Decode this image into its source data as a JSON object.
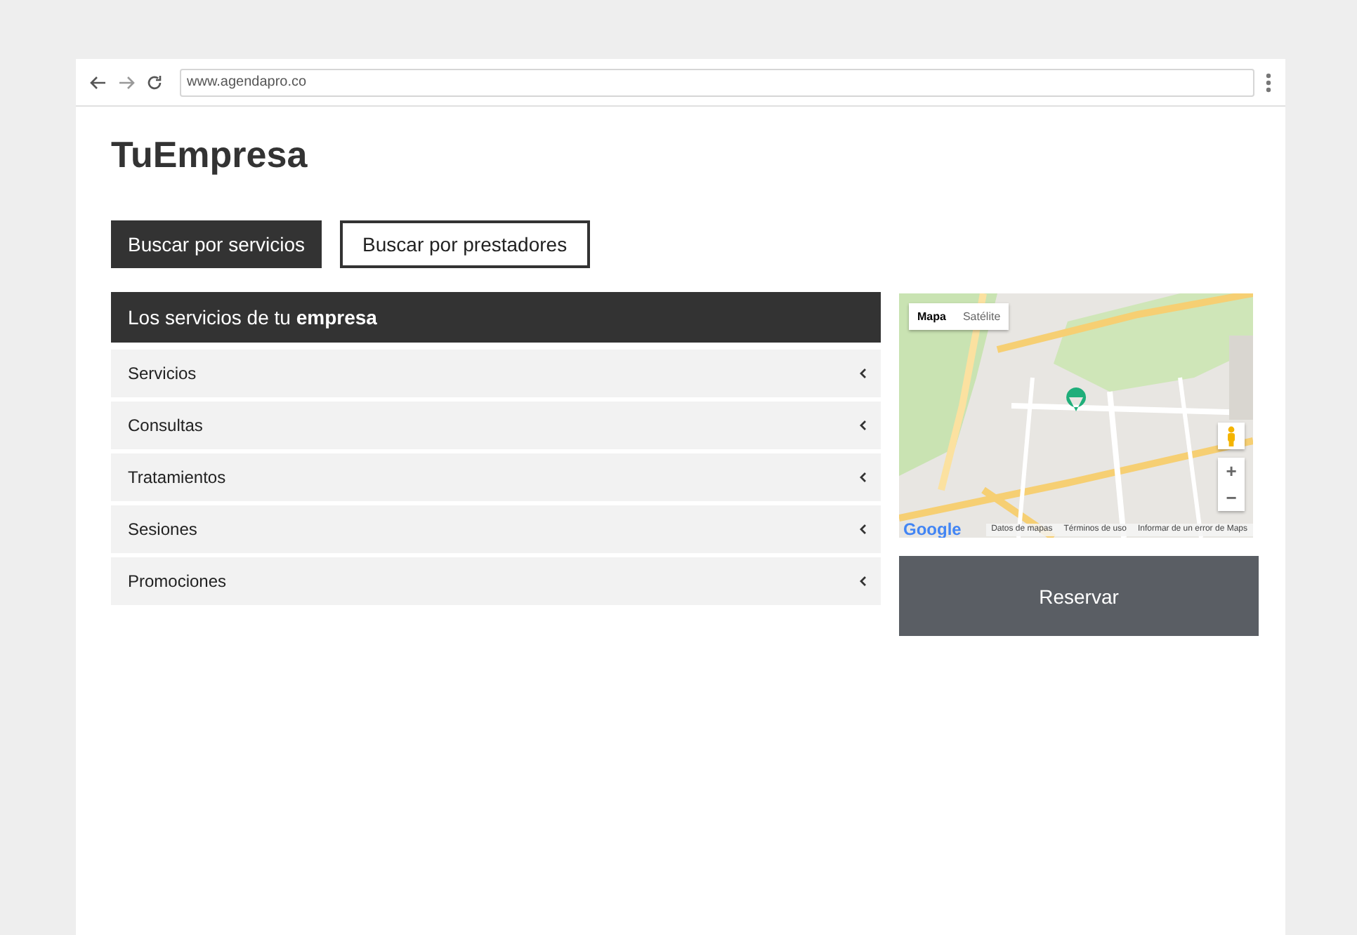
{
  "browser": {
    "url": "www.agendapro.co"
  },
  "company": "TuEmpresa",
  "tabs": [
    {
      "label": "Buscar por servicios",
      "selected": true
    },
    {
      "label": "Buscar por prestadores",
      "selected": false
    }
  ],
  "services": {
    "heading": "Los servicios de tu **empresa**",
    "items": [
      {
        "label": "Servicios",
        "expanded": false
      },
      {
        "label": "Consultas",
        "expanded": false
      },
      {
        "label": "Tratamientos",
        "expanded": false
      },
      {
        "label": "Sesiones",
        "expanded": false
      },
      {
        "label": "Promociones",
        "expanded": false
      }
    ]
  },
  "map": {
    "kind": "picture",
    "map_types": [
      {
        "label": "Mapa",
        "selected": true
      },
      {
        "label": "Satélite",
        "selected": false
      }
    ],
    "zoom": [
      "+",
      "−"
    ],
    "logo": "Google",
    "footer": [
      "Datos de mapas",
      "Términos de uso",
      "Informar de un error de Maps"
    ]
  },
  "reserve_button": "Reservar"
}
